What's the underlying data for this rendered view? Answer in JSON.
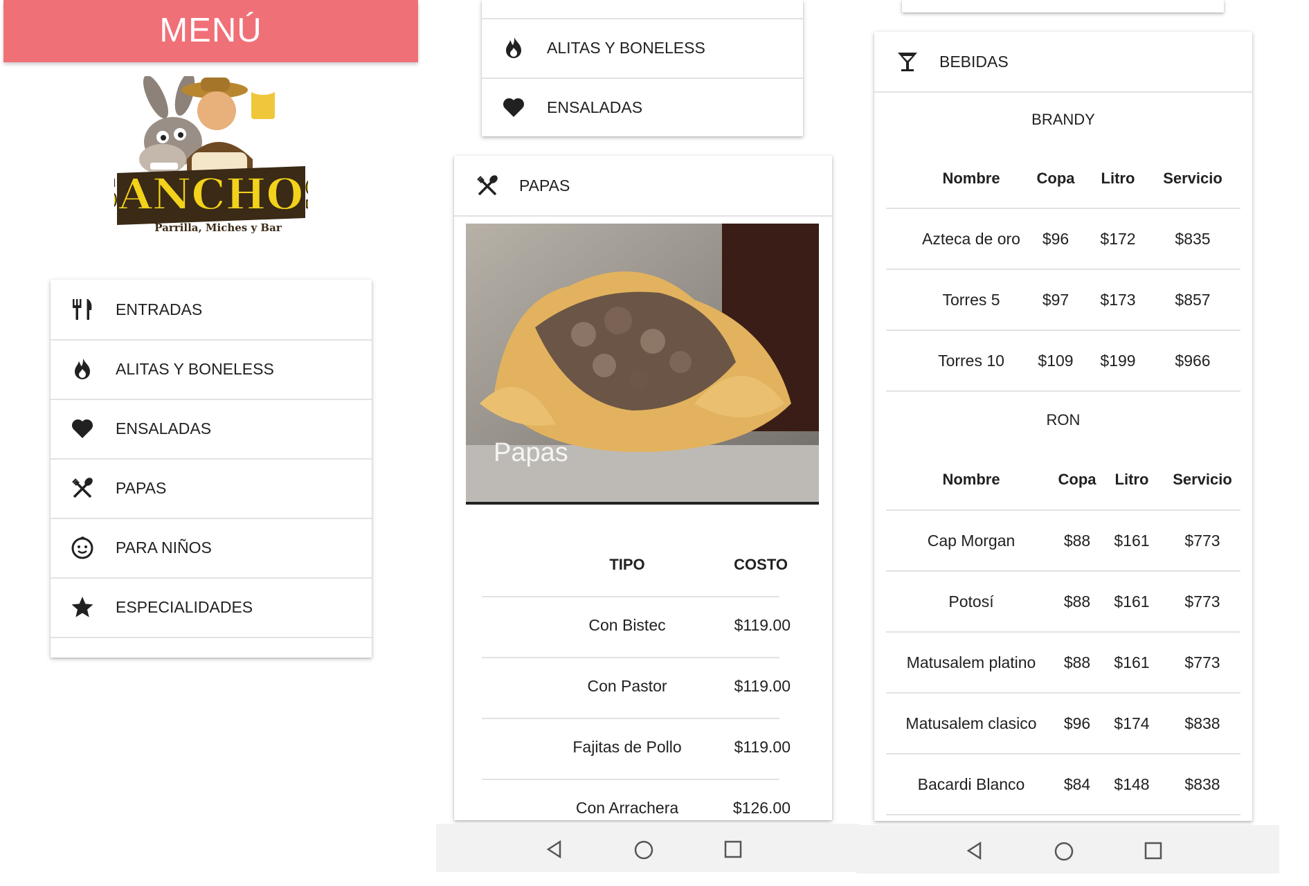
{
  "screen1": {
    "header_title": "MENÚ",
    "logo": {
      "brand": "SANCHOS",
      "tagline": "Parrilla, Miches y Bar"
    },
    "categories": [
      {
        "label": "ENTRADAS",
        "icon": "utensils-icon"
      },
      {
        "label": "ALITAS Y BONELESS",
        "icon": "fire-icon"
      },
      {
        "label": "ENSALADAS",
        "icon": "heart-icon"
      },
      {
        "label": "PAPAS",
        "icon": "fork-spoon-cross-icon"
      },
      {
        "label": "PARA NIÑOS",
        "icon": "child-face-icon"
      },
      {
        "label": "ESPECIALIDADES",
        "icon": "star-icon"
      }
    ]
  },
  "screen2": {
    "top_list": [
      {
        "label": "ALITAS Y BONELESS",
        "icon": "fire-icon"
      },
      {
        "label": "ENSALADAS",
        "icon": "heart-icon"
      }
    ],
    "section_title": "PAPAS",
    "photo_caption": "Papas",
    "table": {
      "headers": [
        "TIPO",
        "COSTO"
      ],
      "rows": [
        [
          "Con Bistec",
          "$119.00"
        ],
        [
          "Con Pastor",
          "$119.00"
        ],
        [
          "Fajitas de Pollo",
          "$119.00"
        ],
        [
          "Con Arrachera",
          "$126.00"
        ]
      ]
    }
  },
  "screen3": {
    "section_title": "BEBIDAS",
    "groups": [
      {
        "name": "BRANDY",
        "headers": [
          "Nombre",
          "Copa",
          "Litro",
          "Servicio"
        ],
        "rows": [
          [
            "Azteca de oro",
            "$96",
            "$172",
            "$835"
          ],
          [
            "Torres 5",
            "$97",
            "$173",
            "$857"
          ],
          [
            "Torres 10",
            "$109",
            "$199",
            "$966"
          ]
        ]
      },
      {
        "name": "RON",
        "headers": [
          "Nombre",
          "Copa",
          "Litro",
          "Servicio"
        ],
        "rows": [
          [
            "Cap Morgan",
            "$88",
            "$161",
            "$773"
          ],
          [
            "Potosí",
            "$88",
            "$161",
            "$773"
          ],
          [
            "Matusalem platino",
            "$88",
            "$161",
            "$773"
          ],
          [
            "Matusalem clasico",
            "$96",
            "$174",
            "$838"
          ],
          [
            "Bacardi Blanco",
            "$84",
            "$148",
            "$838"
          ]
        ]
      }
    ]
  },
  "navbar": {
    "back": "back-triangle-icon",
    "home": "home-circle-icon",
    "recents": "recents-square-icon"
  },
  "colors": {
    "header_bg": "#f07078",
    "divider": "#e2e2e2",
    "navbar_bg": "#f2f2f2"
  }
}
